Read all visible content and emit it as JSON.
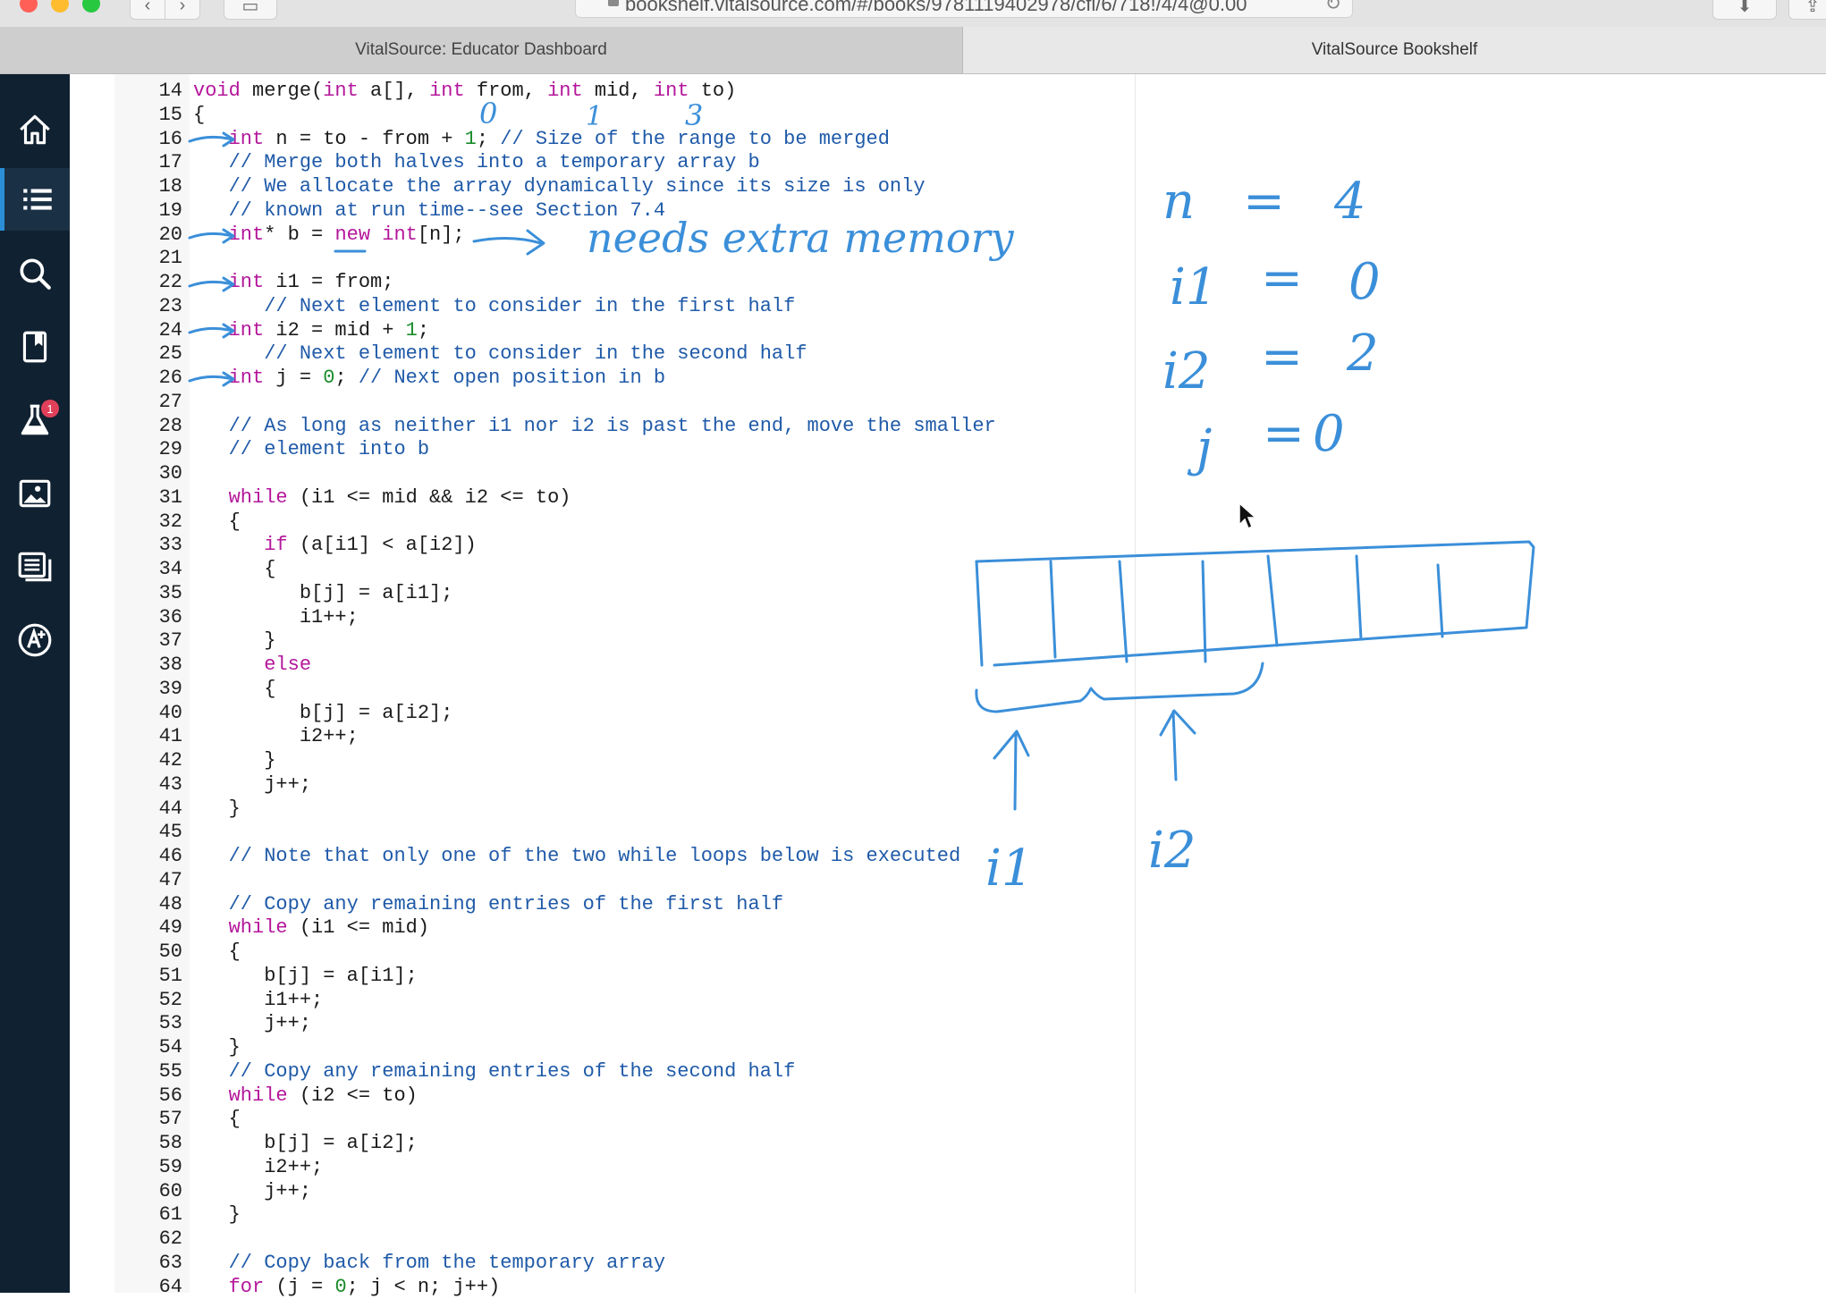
{
  "browser": {
    "url": "bookshelf.vitalsource.com/#/books/9781119402978/cfi/6/718!/4/4@0.00",
    "tabs": [
      {
        "label": "VitalSource: Educator Dashboard",
        "active": false
      },
      {
        "label": "VitalSource Bookshelf",
        "active": true
      }
    ]
  },
  "nav": {
    "items": [
      {
        "icon": "home-icon"
      },
      {
        "icon": "table-of-contents-icon",
        "active": true
      },
      {
        "icon": "search-icon"
      },
      {
        "icon": "bookmark-icon"
      },
      {
        "icon": "flask-icon",
        "badge": "1"
      },
      {
        "icon": "image-icon"
      },
      {
        "icon": "notes-icon"
      },
      {
        "icon": "accessibility-icon"
      }
    ],
    "accent": "#2b8fd7",
    "background": "#102131",
    "badge_color": "#e0405a"
  },
  "code": {
    "lines": [
      {
        "n": "14",
        "text": "void merge(int a[], int from, int mid, int to)"
      },
      {
        "n": "15",
        "text": "{"
      },
      {
        "n": "16",
        "text": "   int n = to - from + 1; // Size of the range to be merged"
      },
      {
        "n": "17",
        "text": "   // Merge both halves into a temporary array b"
      },
      {
        "n": "18",
        "text": "   // We allocate the array dynamically since its size is only"
      },
      {
        "n": "19",
        "text": "   // known at run time--see Section 7.4"
      },
      {
        "n": "20",
        "text": "   int* b = new int[n];"
      },
      {
        "n": "21",
        "text": ""
      },
      {
        "n": "22",
        "text": "   int i1 = from;"
      },
      {
        "n": "23",
        "text": "      // Next element to consider in the first half"
      },
      {
        "n": "24",
        "text": "   int i2 = mid + 1;"
      },
      {
        "n": "25",
        "text": "      // Next element to consider in the second half"
      },
      {
        "n": "26",
        "text": "   int j = 0; // Next open position in b"
      },
      {
        "n": "27",
        "text": ""
      },
      {
        "n": "28",
        "text": "   // As long as neither i1 nor i2 is past the end, move the smaller"
      },
      {
        "n": "29",
        "text": "   // element into b"
      },
      {
        "n": "30",
        "text": ""
      },
      {
        "n": "31",
        "text": "   while (i1 <= mid && i2 <= to)"
      },
      {
        "n": "32",
        "text": "   {"
      },
      {
        "n": "33",
        "text": "      if (a[i1] < a[i2])"
      },
      {
        "n": "34",
        "text": "      {"
      },
      {
        "n": "35",
        "text": "         b[j] = a[i1];"
      },
      {
        "n": "36",
        "text": "         i1++;"
      },
      {
        "n": "37",
        "text": "      }"
      },
      {
        "n": "38",
        "text": "      else"
      },
      {
        "n": "39",
        "text": "      {"
      },
      {
        "n": "40",
        "text": "         b[j] = a[i2];"
      },
      {
        "n": "41",
        "text": "         i2++;"
      },
      {
        "n": "42",
        "text": "      }"
      },
      {
        "n": "43",
        "text": "      j++;"
      },
      {
        "n": "44",
        "text": "   }"
      },
      {
        "n": "45",
        "text": ""
      },
      {
        "n": "46",
        "text": "   // Note that only one of the two while loops below is executed"
      },
      {
        "n": "47",
        "text": ""
      },
      {
        "n": "48",
        "text": "   // Copy any remaining entries of the first half"
      },
      {
        "n": "49",
        "text": "   while (i1 <= mid)"
      },
      {
        "n": "50",
        "text": "   {"
      },
      {
        "n": "51",
        "text": "      b[j] = a[i1];"
      },
      {
        "n": "52",
        "text": "      i1++;"
      },
      {
        "n": "53",
        "text": "      j++;"
      },
      {
        "n": "54",
        "text": "   }"
      },
      {
        "n": "55",
        "text": "   // Copy any remaining entries of the second half"
      },
      {
        "n": "56",
        "text": "   while (i2 <= to)"
      },
      {
        "n": "57",
        "text": "   {"
      },
      {
        "n": "58",
        "text": "      b[j] = a[i2];"
      },
      {
        "n": "59",
        "text": "      i2++;"
      },
      {
        "n": "60",
        "text": "      j++;"
      },
      {
        "n": "61",
        "text": "   }"
      },
      {
        "n": "62",
        "text": ""
      },
      {
        "n": "63",
        "text": "   // Copy back from the temporary array"
      },
      {
        "n": "64",
        "text": "   for (j = 0; j < n; j++)"
      }
    ],
    "colors": {
      "keyword": "#b4169b",
      "comment": "#1f5aa8",
      "number": "#1a8c2b"
    }
  },
  "annotations": {
    "ink_color": "#3b8fd9",
    "param_values": [
      "0",
      "1",
      "3"
    ],
    "note": "needs extra memory",
    "variables": [
      {
        "name": "n",
        "value": "4"
      },
      {
        "name": "i1",
        "value": "0"
      },
      {
        "name": "i2",
        "value": "2"
      },
      {
        "name": "j",
        "value": "0"
      }
    ],
    "pointer_labels": [
      "i1",
      "i2"
    ]
  }
}
